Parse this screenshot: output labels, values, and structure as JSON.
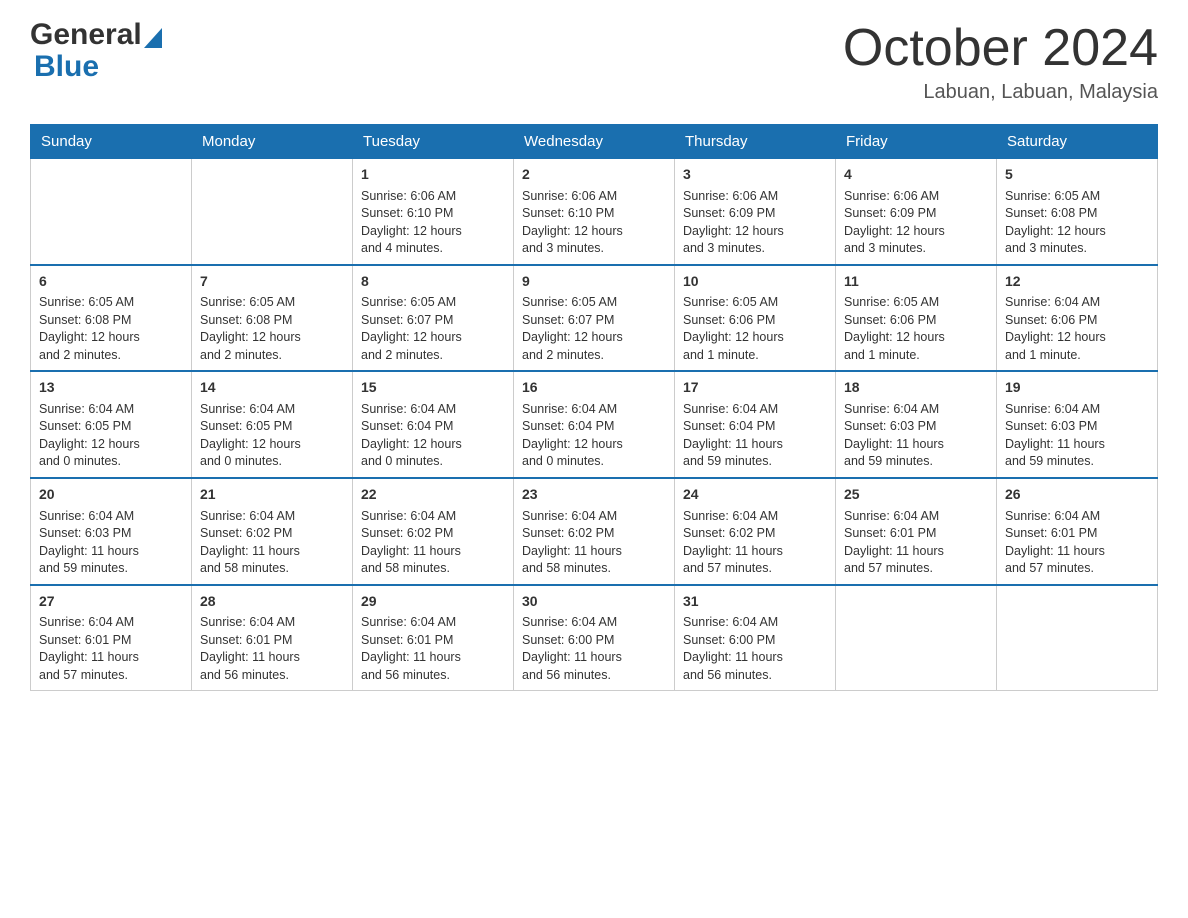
{
  "header": {
    "month_year": "October 2024",
    "location": "Labuan, Labuan, Malaysia",
    "logo_general": "General",
    "logo_blue": "Blue"
  },
  "days_of_week": [
    "Sunday",
    "Monday",
    "Tuesday",
    "Wednesday",
    "Thursday",
    "Friday",
    "Saturday"
  ],
  "weeks": [
    [
      {
        "day": "",
        "info": ""
      },
      {
        "day": "",
        "info": ""
      },
      {
        "day": "1",
        "info": "Sunrise: 6:06 AM\nSunset: 6:10 PM\nDaylight: 12 hours\nand 4 minutes."
      },
      {
        "day": "2",
        "info": "Sunrise: 6:06 AM\nSunset: 6:10 PM\nDaylight: 12 hours\nand 3 minutes."
      },
      {
        "day": "3",
        "info": "Sunrise: 6:06 AM\nSunset: 6:09 PM\nDaylight: 12 hours\nand 3 minutes."
      },
      {
        "day": "4",
        "info": "Sunrise: 6:06 AM\nSunset: 6:09 PM\nDaylight: 12 hours\nand 3 minutes."
      },
      {
        "day": "5",
        "info": "Sunrise: 6:05 AM\nSunset: 6:08 PM\nDaylight: 12 hours\nand 3 minutes."
      }
    ],
    [
      {
        "day": "6",
        "info": "Sunrise: 6:05 AM\nSunset: 6:08 PM\nDaylight: 12 hours\nand 2 minutes."
      },
      {
        "day": "7",
        "info": "Sunrise: 6:05 AM\nSunset: 6:08 PM\nDaylight: 12 hours\nand 2 minutes."
      },
      {
        "day": "8",
        "info": "Sunrise: 6:05 AM\nSunset: 6:07 PM\nDaylight: 12 hours\nand 2 minutes."
      },
      {
        "day": "9",
        "info": "Sunrise: 6:05 AM\nSunset: 6:07 PM\nDaylight: 12 hours\nand 2 minutes."
      },
      {
        "day": "10",
        "info": "Sunrise: 6:05 AM\nSunset: 6:06 PM\nDaylight: 12 hours\nand 1 minute."
      },
      {
        "day": "11",
        "info": "Sunrise: 6:05 AM\nSunset: 6:06 PM\nDaylight: 12 hours\nand 1 minute."
      },
      {
        "day": "12",
        "info": "Sunrise: 6:04 AM\nSunset: 6:06 PM\nDaylight: 12 hours\nand 1 minute."
      }
    ],
    [
      {
        "day": "13",
        "info": "Sunrise: 6:04 AM\nSunset: 6:05 PM\nDaylight: 12 hours\nand 0 minutes."
      },
      {
        "day": "14",
        "info": "Sunrise: 6:04 AM\nSunset: 6:05 PM\nDaylight: 12 hours\nand 0 minutes."
      },
      {
        "day": "15",
        "info": "Sunrise: 6:04 AM\nSunset: 6:04 PM\nDaylight: 12 hours\nand 0 minutes."
      },
      {
        "day": "16",
        "info": "Sunrise: 6:04 AM\nSunset: 6:04 PM\nDaylight: 12 hours\nand 0 minutes."
      },
      {
        "day": "17",
        "info": "Sunrise: 6:04 AM\nSunset: 6:04 PM\nDaylight: 11 hours\nand 59 minutes."
      },
      {
        "day": "18",
        "info": "Sunrise: 6:04 AM\nSunset: 6:03 PM\nDaylight: 11 hours\nand 59 minutes."
      },
      {
        "day": "19",
        "info": "Sunrise: 6:04 AM\nSunset: 6:03 PM\nDaylight: 11 hours\nand 59 minutes."
      }
    ],
    [
      {
        "day": "20",
        "info": "Sunrise: 6:04 AM\nSunset: 6:03 PM\nDaylight: 11 hours\nand 59 minutes."
      },
      {
        "day": "21",
        "info": "Sunrise: 6:04 AM\nSunset: 6:02 PM\nDaylight: 11 hours\nand 58 minutes."
      },
      {
        "day": "22",
        "info": "Sunrise: 6:04 AM\nSunset: 6:02 PM\nDaylight: 11 hours\nand 58 minutes."
      },
      {
        "day": "23",
        "info": "Sunrise: 6:04 AM\nSunset: 6:02 PM\nDaylight: 11 hours\nand 58 minutes."
      },
      {
        "day": "24",
        "info": "Sunrise: 6:04 AM\nSunset: 6:02 PM\nDaylight: 11 hours\nand 57 minutes."
      },
      {
        "day": "25",
        "info": "Sunrise: 6:04 AM\nSunset: 6:01 PM\nDaylight: 11 hours\nand 57 minutes."
      },
      {
        "day": "26",
        "info": "Sunrise: 6:04 AM\nSunset: 6:01 PM\nDaylight: 11 hours\nand 57 minutes."
      }
    ],
    [
      {
        "day": "27",
        "info": "Sunrise: 6:04 AM\nSunset: 6:01 PM\nDaylight: 11 hours\nand 57 minutes."
      },
      {
        "day": "28",
        "info": "Sunrise: 6:04 AM\nSunset: 6:01 PM\nDaylight: 11 hours\nand 56 minutes."
      },
      {
        "day": "29",
        "info": "Sunrise: 6:04 AM\nSunset: 6:01 PM\nDaylight: 11 hours\nand 56 minutes."
      },
      {
        "day": "30",
        "info": "Sunrise: 6:04 AM\nSunset: 6:00 PM\nDaylight: 11 hours\nand 56 minutes."
      },
      {
        "day": "31",
        "info": "Sunrise: 6:04 AM\nSunset: 6:00 PM\nDaylight: 11 hours\nand 56 minutes."
      },
      {
        "day": "",
        "info": ""
      },
      {
        "day": "",
        "info": ""
      }
    ]
  ]
}
